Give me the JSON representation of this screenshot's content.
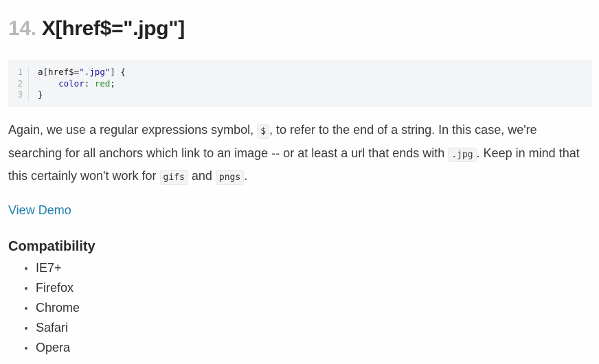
{
  "heading": {
    "number": "14.",
    "title": "X[href$=\".jpg\"]"
  },
  "code": {
    "line_numbers": [
      "1",
      "2",
      "3"
    ],
    "line1": {
      "selector_start": "a[href$=",
      "selector_string": "\".jpg\"",
      "selector_end": "] {"
    },
    "line2": {
      "indent": "    ",
      "property": "color",
      "colon": ": ",
      "value": "red",
      "semicolon": ";"
    },
    "line3": "}"
  },
  "paragraph": {
    "t1": "Again, we use a regular expressions symbol, ",
    "c1": "$",
    "t2": ", to refer to the end of a string. In this case, we're searching for all anchors which link to an image -- or at least a url that ends with ",
    "c2": ".jpg",
    "t3": ". Keep in mind that this certainly won't work for ",
    "c3": "gifs",
    "t4": " and ",
    "c4": "pngs",
    "t5": "."
  },
  "demo_link": "View Demo",
  "compatibility": {
    "title": "Compatibility",
    "browsers": [
      "IE7+",
      "Firefox",
      "Chrome",
      "Safari",
      "Opera"
    ]
  },
  "colors": {
    "link": "#1d7fb0",
    "heading_number": "#b9b9b9",
    "code_bg": "#f4f5f7"
  }
}
